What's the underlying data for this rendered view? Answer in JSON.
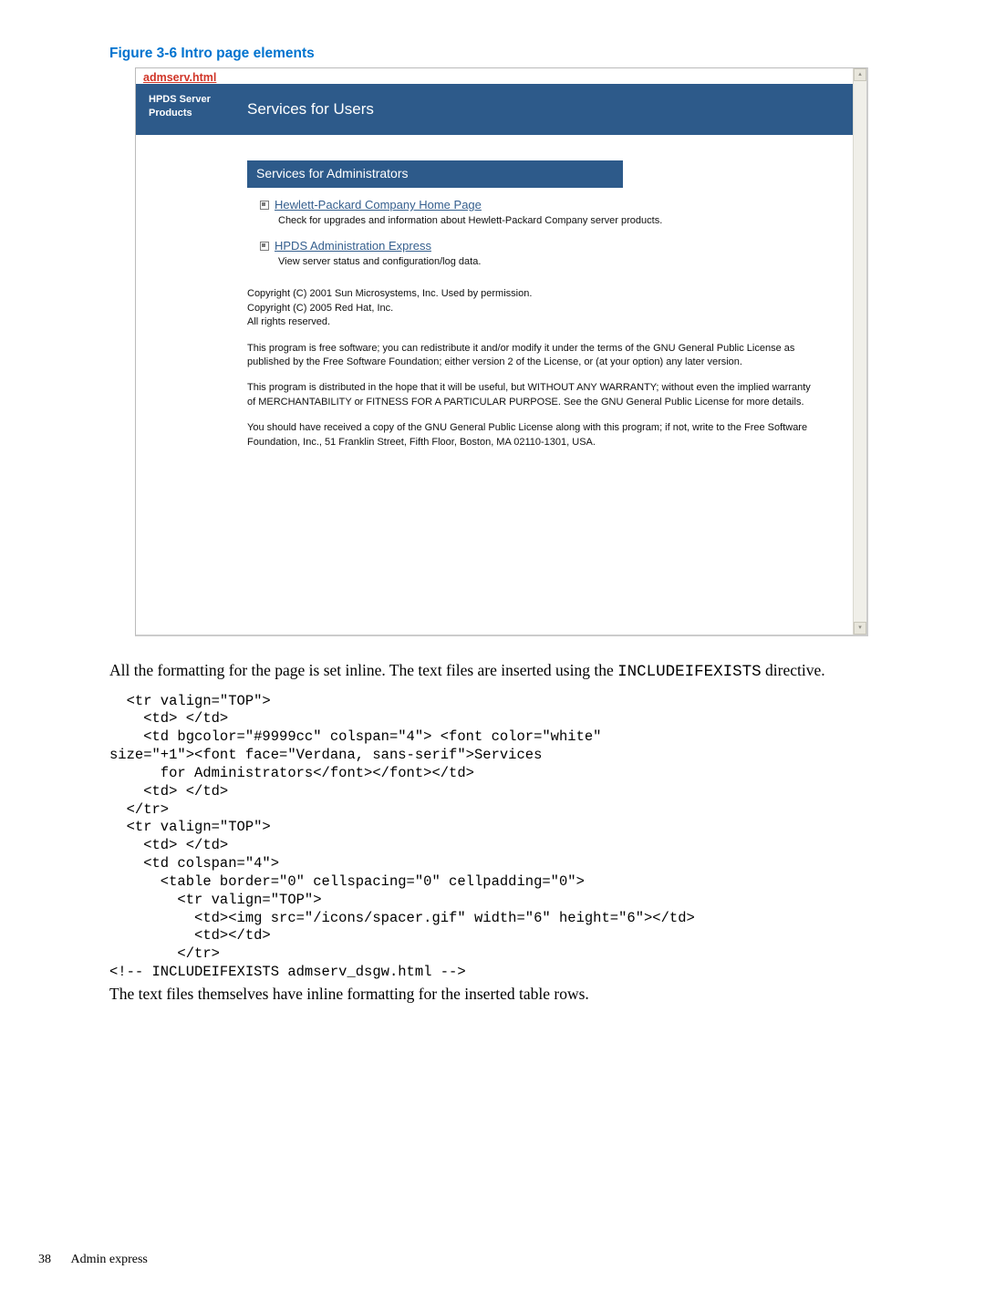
{
  "figure_label": "Figure 3-6 Intro page elements",
  "screenshot": {
    "file_title": "admserv.html",
    "sidebar": "HPDS Server Products",
    "header": "Services for Users",
    "svc_admin_heading": "Services for Administrators",
    "links": [
      {
        "label": "Hewlett-Packard Company Home Page",
        "desc": "Check for upgrades and information about Hewlett-Packard Company server products."
      },
      {
        "label": "HPDS Administration Express",
        "desc": "View server status and configuration/log data."
      }
    ],
    "legal": [
      "Copyright (C) 2001 Sun Microsystems, Inc. Used by permission.\nCopyright (C) 2005 Red Hat, Inc.\nAll rights reserved.",
      "This program is free software; you can redistribute it and/or modify it under the terms of the GNU General Public License as published by the Free Software Foundation; either version 2 of the License, or (at your option) any later version.",
      "This program is distributed in the hope that it will be useful, but WITHOUT ANY WARRANTY; without even the implied warranty of MERCHANTABILITY or FITNESS FOR A PARTICULAR PURPOSE. See the GNU General Public License for more details.",
      "You should have received a copy of the GNU General Public License along with this program; if not, write to the Free Software Foundation, Inc., 51 Franklin Street, Fifth Floor, Boston, MA 02110-1301, USA."
    ]
  },
  "para1_a": "All the formatting for the page is set inline. The text files are inserted using the ",
  "para1_code": "INCLUDEIFEXISTS",
  "para1_b": " directive.",
  "code_block": "  <tr valign=\"TOP\">\n    <td> </td>\n    <td bgcolor=\"#9999cc\" colspan=\"4\"> <font color=\"white\"\nsize=\"+1\"><font face=\"Verdana, sans-serif\">Services\n      for Administrators</font></font></td>\n    <td> </td>\n  </tr>\n  <tr valign=\"TOP\">\n    <td> </td>\n    <td colspan=\"4\">\n      <table border=\"0\" cellspacing=\"0\" cellpadding=\"0\">\n        <tr valign=\"TOP\">\n          <td><img src=\"/icons/spacer.gif\" width=\"6\" height=\"6\"></td>\n          <td></td>\n        </tr>\n<!-- INCLUDEIFEXISTS admserv_dsgw.html -->",
  "para2": "The text files themselves have inline formatting for the inserted table rows.",
  "footer_page": "38",
  "footer_text": "Admin express"
}
